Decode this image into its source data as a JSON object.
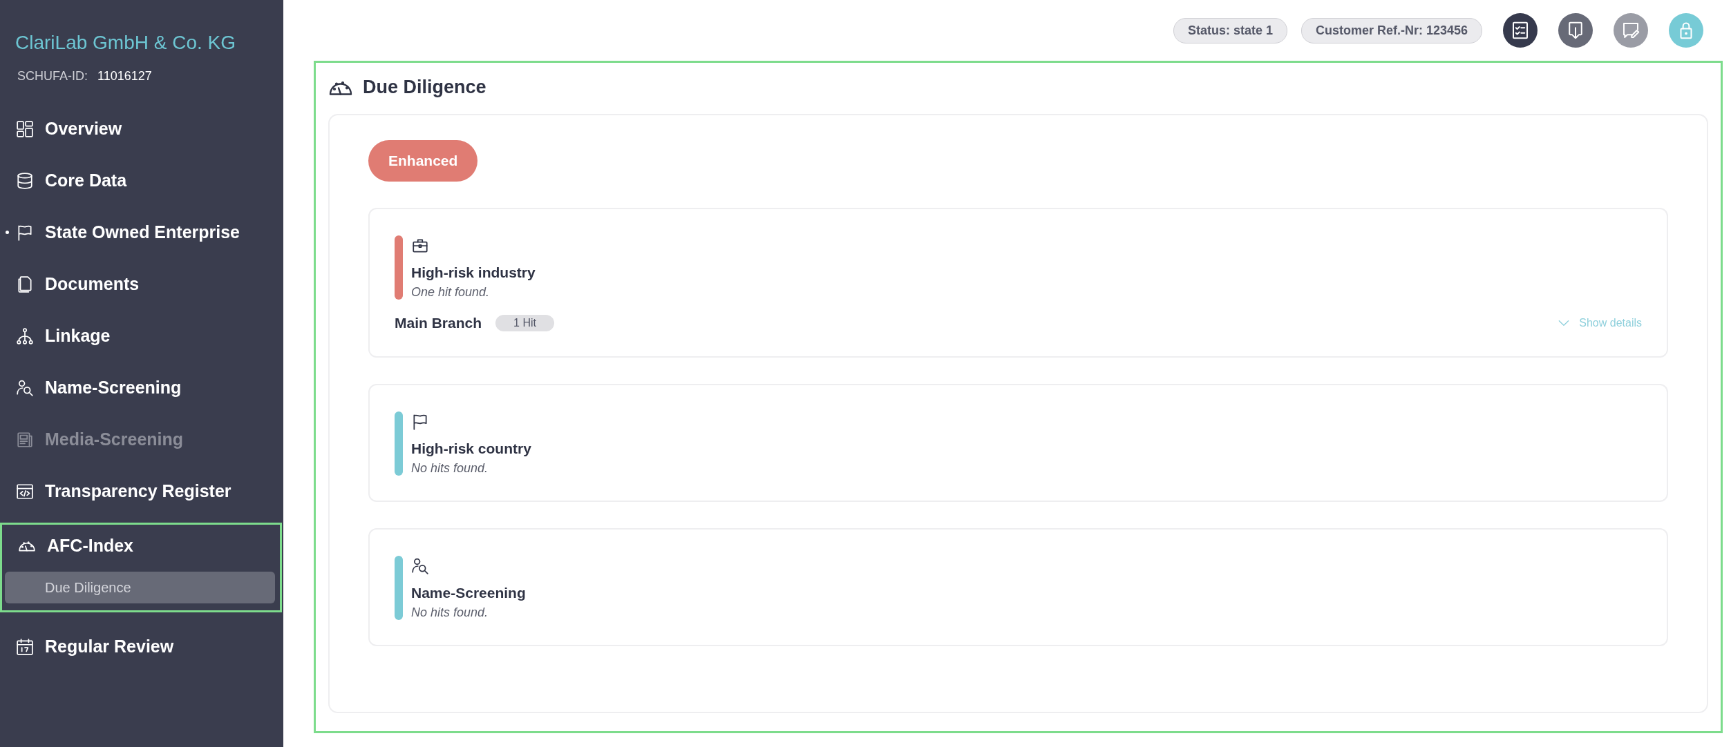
{
  "sidebar": {
    "company": "ClariLab GmbH & Co. KG",
    "id_label": "SCHUFA-ID:",
    "id_value": "11016127",
    "items": [
      {
        "label": "Overview",
        "disabled": false,
        "flagged": false,
        "highlighted": false
      },
      {
        "label": "Core Data",
        "disabled": false,
        "flagged": false,
        "highlighted": false
      },
      {
        "label": "State Owned Enterprise",
        "disabled": false,
        "flagged": true,
        "highlighted": false
      },
      {
        "label": "Documents",
        "disabled": false,
        "flagged": false,
        "highlighted": false
      },
      {
        "label": "Linkage",
        "disabled": false,
        "flagged": false,
        "highlighted": false
      },
      {
        "label": "Name-Screening",
        "disabled": false,
        "flagged": false,
        "highlighted": false
      },
      {
        "label": "Media-Screening",
        "disabled": true,
        "flagged": false,
        "highlighted": false
      },
      {
        "label": "Transparency Register",
        "disabled": false,
        "flagged": false,
        "highlighted": false
      },
      {
        "label": "AFC-Index",
        "disabled": false,
        "flagged": false,
        "highlighted": true,
        "children": [
          {
            "label": "Due Diligence",
            "selected": true
          }
        ]
      },
      {
        "label": "Regular Review",
        "disabled": false,
        "flagged": false,
        "highlighted": false
      }
    ]
  },
  "header": {
    "chips": [
      "Status: state 1",
      "Customer Ref.-Nr: 123456"
    ]
  },
  "content": {
    "highlighted": true,
    "title": "Due Diligence",
    "level": {
      "label": "Enhanced",
      "color": "#e07c73"
    },
    "checks": [
      {
        "title": "High-risk industry",
        "result": "One hit found.",
        "color": "#e07c73",
        "branches": [
          {
            "name": "Main Branch",
            "hits": "1 Hit"
          }
        ],
        "details_link": "Show details"
      },
      {
        "title": "High-risk country",
        "result": "No hits found.",
        "color": "#7ccbd6"
      },
      {
        "title": "Name-Screening",
        "result": "No hits found.",
        "color": "#7ccbd6"
      }
    ]
  }
}
